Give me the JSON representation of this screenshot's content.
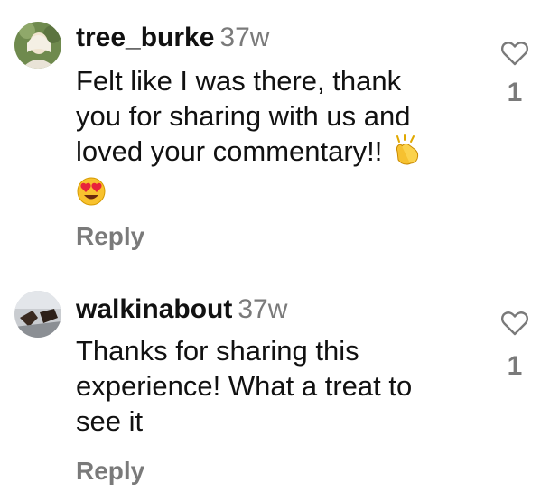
{
  "comments": [
    {
      "username": "tree_burke",
      "time": "37w",
      "text_lines": [
        "Felt like I was there, thank",
        "you for sharing with us and",
        "loved your commentary!!"
      ],
      "emojis": [
        "clapping-hands-emoji",
        "heart-eyes-emoji"
      ],
      "reply_label": "Reply",
      "like_count": "1"
    },
    {
      "username": "walkinabout",
      "time": "37w",
      "text_lines": [
        "Thanks for sharing this",
        "experience! What a treat to",
        "see it"
      ],
      "reply_label": "Reply",
      "like_count": "1"
    }
  ],
  "icons": {
    "like": "heart-outline-icon"
  },
  "colors": {
    "text": "#111111",
    "secondary": "#7a7a7a",
    "background": "#ffffff"
  }
}
